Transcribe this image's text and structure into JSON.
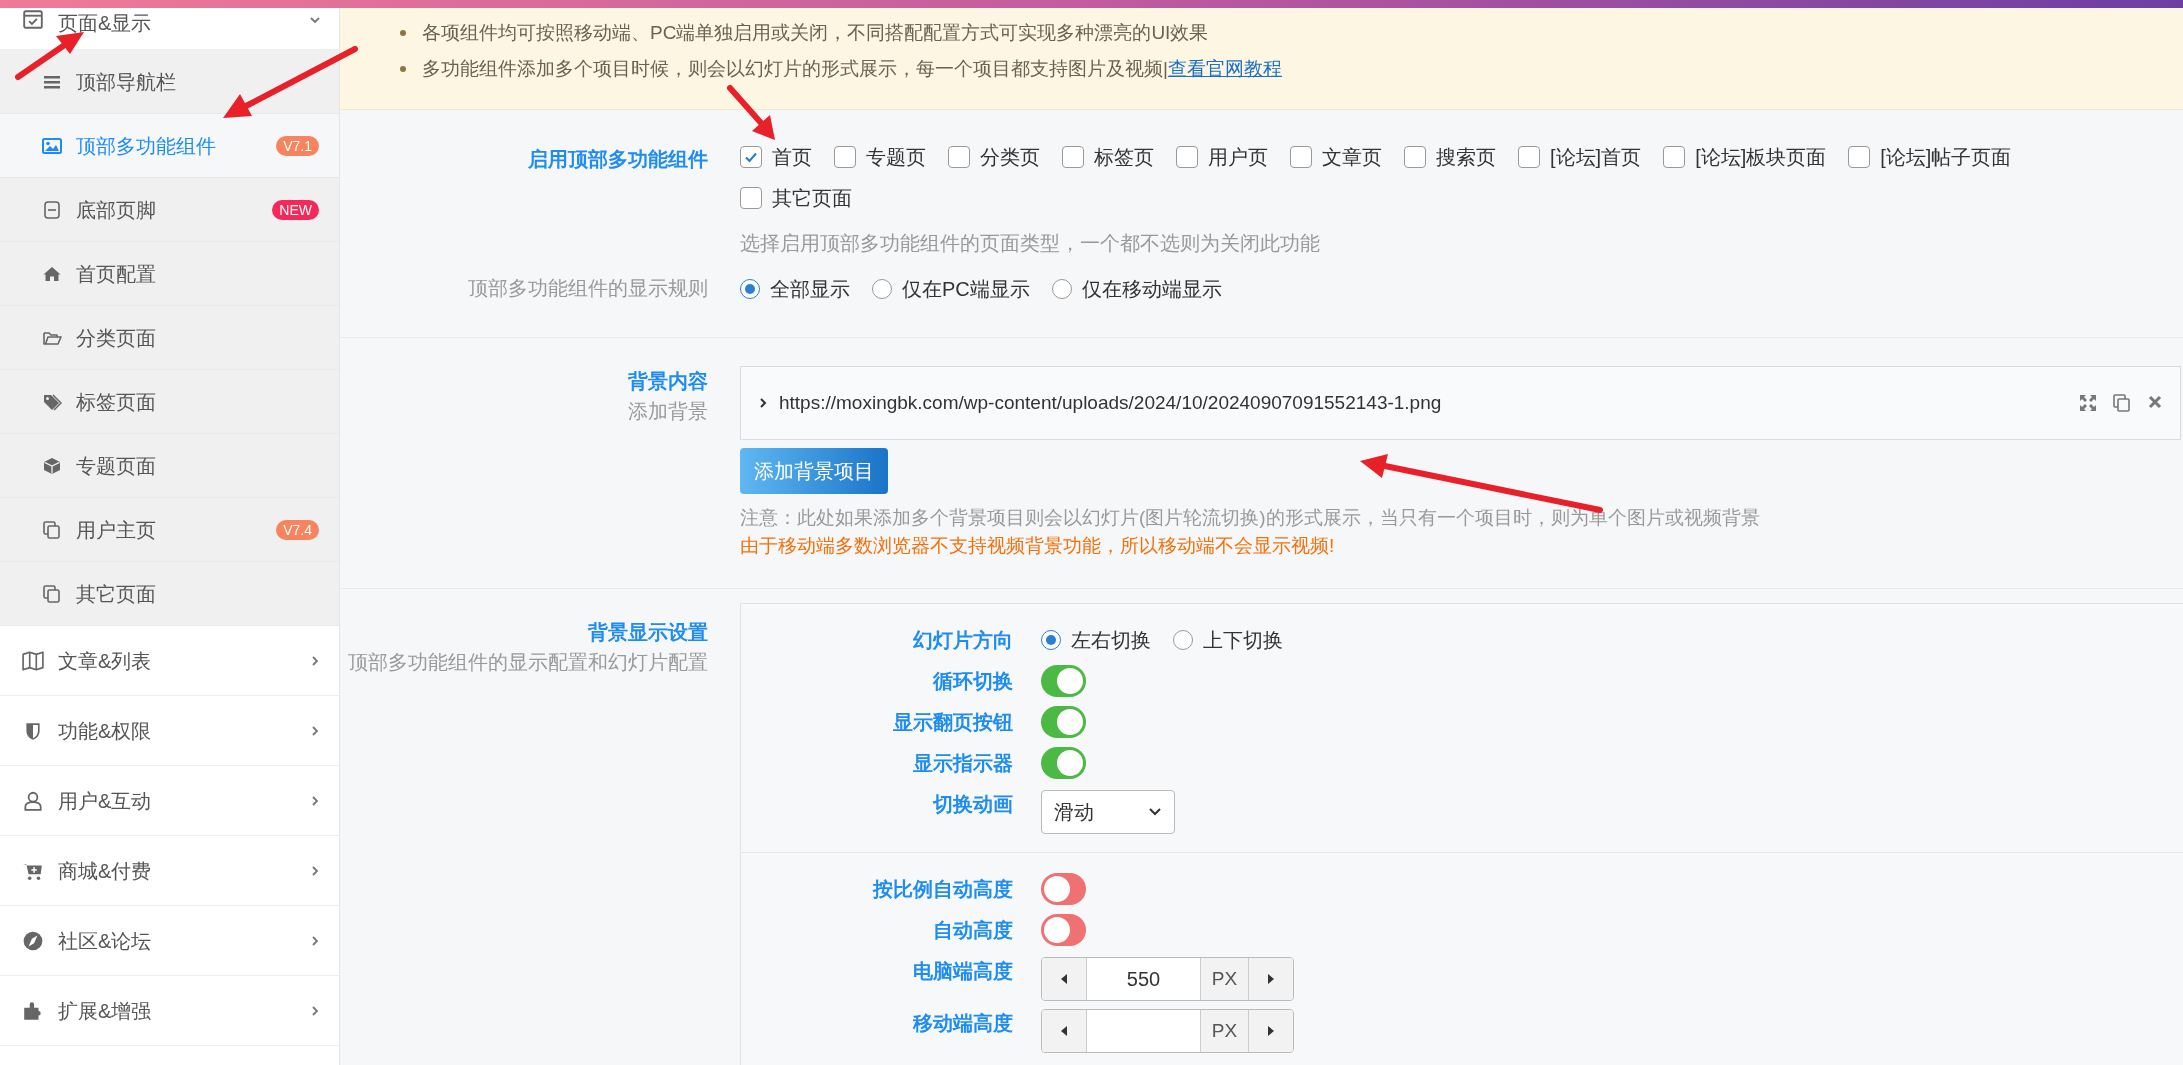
{
  "sidebar": {
    "items": [
      {
        "label": "页面&显示",
        "expanded": true,
        "children": [
          {
            "label": "顶部导航栏",
            "selected": false
          },
          {
            "label": "顶部多功能组件",
            "selected": true,
            "badge": {
              "text": "V7.1",
              "color": "#f8845f"
            }
          },
          {
            "label": "底部页脚",
            "selected": false,
            "badge": {
              "text": "NEW",
              "color": "#f5285a"
            }
          },
          {
            "label": "首页配置",
            "selected": false
          },
          {
            "label": "分类页面",
            "selected": false
          },
          {
            "label": "标签页面",
            "selected": false
          },
          {
            "label": "专题页面",
            "selected": false
          },
          {
            "label": "用户主页",
            "selected": false,
            "badge": {
              "text": "V7.4",
              "color": "#f8845f"
            }
          },
          {
            "label": "其它页面",
            "selected": false
          }
        ]
      },
      {
        "label": "文章&列表",
        "expanded": false
      },
      {
        "label": "功能&权限",
        "expanded": false
      },
      {
        "label": "用户&互动",
        "expanded": false
      },
      {
        "label": "商城&付费",
        "expanded": false
      },
      {
        "label": "社区&论坛",
        "expanded": false
      },
      {
        "label": "扩展&增强",
        "expanded": false
      }
    ]
  },
  "notice": {
    "items": [
      {
        "text": "各项组件均可按照移动端、PC端单独启用或关闭，不同搭配配置方式可实现多种漂亮的UI效果"
      },
      {
        "text": "多功能组件添加多个项目时候，则会以幻灯片的形式展示，每一个项目都支持图片及视频|",
        "link": "查看官网教程"
      }
    ]
  },
  "enable_pages": {
    "label": "启用顶部多功能组件",
    "options": [
      {
        "label": "首页",
        "checked": true
      },
      {
        "label": "专题页",
        "checked": false
      },
      {
        "label": "分类页",
        "checked": false
      },
      {
        "label": "标签页",
        "checked": false
      },
      {
        "label": "用户页",
        "checked": false
      },
      {
        "label": "文章页",
        "checked": false
      },
      {
        "label": "搜索页",
        "checked": false
      },
      {
        "label": "[论坛]首页",
        "checked": false
      },
      {
        "label": "[论坛]板块页面",
        "checked": false
      },
      {
        "label": "[论坛]帖子页面",
        "checked": false
      },
      {
        "label": "其它页面",
        "checked": false
      }
    ],
    "hint": "选择启用顶部多功能组件的页面类型，一个都不选则为关闭此功能"
  },
  "display_rule": {
    "label": "顶部多功能组件的显示规则",
    "options": [
      {
        "label": "全部显示",
        "selected": true
      },
      {
        "label": "仅在PC端显示",
        "selected": false
      },
      {
        "label": "仅在移动端显示",
        "selected": false
      }
    ]
  },
  "background_content": {
    "title": "背景内容",
    "subtitle": "添加背景",
    "items": [
      {
        "url": "https://moxingbk.com/wp-content/uploads/2024/10/20240907091552143-1.png"
      }
    ],
    "add_button": "添加背景项目",
    "note": "注意：此处如果添加多个背景项目则会以幻灯片(图片轮流切换)的形式展示，当只有一个项目时，则为单个图片或视频背景",
    "warning": "由于移动端多数浏览器不支持视频背景功能，所以移动端不会显示视频!"
  },
  "display_settings": {
    "title": "背景显示设置",
    "subtitle": "顶部多功能组件的显示配置和幻灯片配置",
    "groups": [
      {
        "fields": [
          {
            "kind": "radio",
            "label": "幻灯片方向",
            "options": [
              {
                "label": "左右切换",
                "selected": true
              },
              {
                "label": "上下切换",
                "selected": false
              }
            ]
          },
          {
            "kind": "switch",
            "label": "循环切换",
            "on": true
          },
          {
            "kind": "switch",
            "label": "显示翻页按钮",
            "on": true
          },
          {
            "kind": "switch",
            "label": "显示指示器",
            "on": true
          },
          {
            "kind": "select",
            "label": "切换动画",
            "value": "滑动"
          }
        ]
      },
      {
        "fields": [
          {
            "kind": "switch",
            "label": "按比例自动高度",
            "on": false
          },
          {
            "kind": "switch",
            "label": "自动高度",
            "on": false
          },
          {
            "kind": "number",
            "label": "电脑端高度",
            "value": "550",
            "unit": "PX"
          },
          {
            "kind": "number",
            "label": "移动端高度",
            "unit": "PX"
          }
        ]
      }
    ]
  }
}
